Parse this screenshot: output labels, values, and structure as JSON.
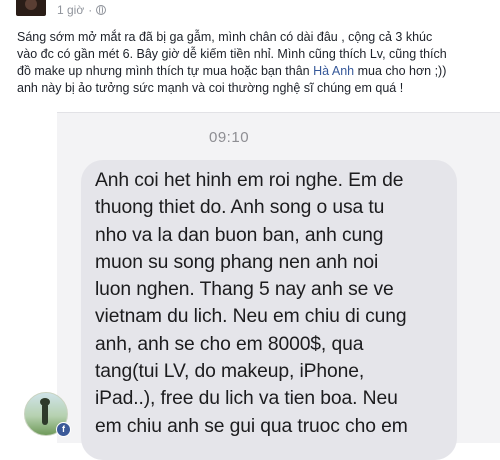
{
  "post": {
    "timestamp": "1 giờ",
    "privacy_icon": "globe-icon",
    "text_lines": {
      "line1": "Sáng sớm mở mắt ra đã bị ga gẫm, mình chân có dài đâu , cộng cả 3 khúc",
      "line2": "vào đc có gần mét 6. Bây giờ dễ kiếm tiền nhỉ. Mình cũng thích Lv, cũng thích",
      "line3_before": "đồ make up nhưng mình thích tự mua hoặc bạn thân ",
      "line3_link": "Hà Anh",
      "line3_after": " mua cho hơn ;))",
      "line4": "anh này bị ảo tưởng sức mạnh và coi thường nghệ sĩ chúng em quá !"
    }
  },
  "sms": {
    "time": "09:10",
    "lines": [
      "Anh coi het hinh em roi nghe. Em de",
      "thuong thiet do. Anh song o usa tu",
      "nho va la dan buon ban, anh cung",
      "muon su song phang nen anh noi",
      "luon nghen. Thang 5 nay anh se ve",
      "vietnam du lich. Neu em chiu di cung",
      "anh, anh se cho em 8000$, qua",
      "tang(tui LV, do makeup, iPhone,",
      "iPad..), free du lich va tien boa. Neu",
      "em chiu anh se gui qua truoc cho em"
    ]
  },
  "commenter": {
    "badge_letter": "f",
    "badge_icon": "facebook-icon"
  },
  "colors": {
    "link": "#365899",
    "bubble": "#e5e5ea",
    "facebook_blue": "#3b5998"
  }
}
